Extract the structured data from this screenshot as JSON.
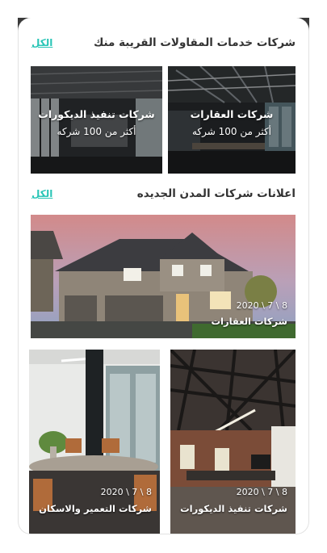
{
  "colors": {
    "accent": "#29c5b6",
    "title": "#333333"
  },
  "contractors_section": {
    "title": "شركات خدمات المقاولات القريبة منك",
    "see_all": "الكل",
    "cards": [
      {
        "title": "شركات العقارات",
        "subtitle": "أكثر من 100 شركه"
      },
      {
        "title": "شركات تنفيذ الديكورات",
        "subtitle": "أكثر من 100 شركه"
      }
    ]
  },
  "ads_section": {
    "title": "اعلانات شركات المدن الجديده",
    "see_all": "الكل",
    "featured": {
      "date": "2020 \\ 7 \\ 8",
      "name": "شركات العقارات"
    },
    "grid": [
      {
        "date": "2020 \\ 7 \\ 8",
        "name": "شركات تنفيذ الديكورات"
      },
      {
        "date": "2020 \\ 7 \\ 8",
        "name": "شركات التعمير والاسكان"
      }
    ]
  }
}
